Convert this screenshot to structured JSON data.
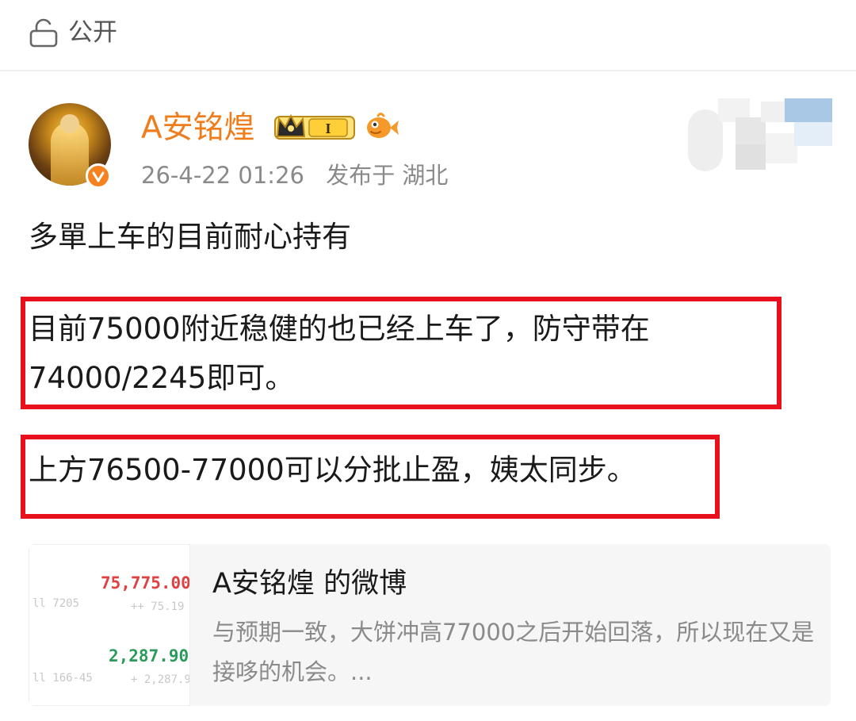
{
  "header": {
    "visibility_label": "公开",
    "visibility_icon": "lock-icon"
  },
  "post": {
    "author": {
      "name": "A安铭煌",
      "member_badge_level": "I",
      "verified_color": "#f5821f",
      "name_color": "#f07d1c"
    },
    "time": "26-4-22 01:26",
    "location": "发布于 湖北",
    "body": {
      "line1": "多單上车的目前耐心持有",
      "para2_line1": "目前75000附近稳健的也已经上车了，防守带在",
      "para2_line2": "74000/2245即可。",
      "para3": "上方76500-77000可以分批止盈，姨太同步。"
    },
    "highlight_color": "#e8101c"
  },
  "repost": {
    "title": "A安铭煌 的微博",
    "excerpt": "与预期一致，大饼冲高77000之后开始回落，所以现在又是接哆的机会。...",
    "thumbnail": {
      "price_red": "75,775.00",
      "price_green": "2,287.90",
      "price_red_color": "#e04040",
      "price_green_color": "#2c9a5a"
    }
  }
}
